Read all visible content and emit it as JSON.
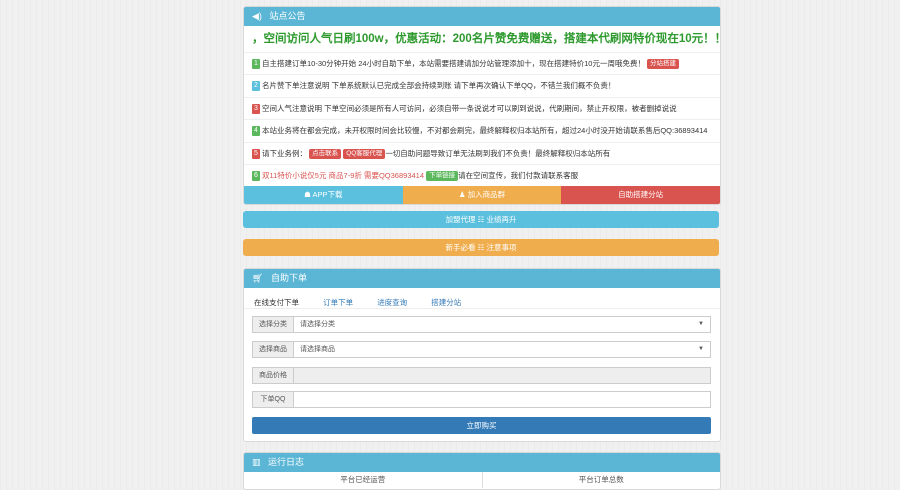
{
  "announce": {
    "title": "站点公告",
    "marquee": "，空间访问人气日刷100w，优惠活动：200名片赞免费赠送，搭建本代刷网特价现在10元！！！",
    "items": [
      {
        "n": "1",
        "color": "#5cb85c",
        "text": "自主搭建订单10-30分钟开始 24小时自助下单，本站需要搭建请加分站管理添加十，现在搭建特价10元一周哦免费！",
        "tag": "分站搭建",
        "tag_color": "#d9534f"
      },
      {
        "n": "2",
        "color": "#5bc0de",
        "text": "名片赞下单注意说明 下单系统默认已完成全部会持续到账 请下单再次确认下单QQ，不错兰我们概不负责！",
        "tag": "",
        "tag_color": ""
      },
      {
        "n": "3",
        "color": "#d9534f",
        "text": "空间人气注意说明 下单空间必须是所有人可访问，必须自带一条说说才可以刷到说说，代刷期间，禁止开权限，被者删掉说说",
        "tag": "",
        "tag_color": ""
      },
      {
        "n": "4",
        "color": "#5cb85c",
        "text": "本站业务将在都会完成，未开权限时间会比较慢，不对都会刷完，最终解释权归本站所有，超过24小时没开始请联系售后QQ:36893414",
        "tag": "",
        "tag_color": ""
      },
      {
        "n": "5",
        "color": "#d9534f",
        "text": "请下业务例：",
        "tag": "点击联系",
        "tag_color": "#d9534f",
        "tag2": "QQ客服代理",
        "text2": "一切自助问题导致订单无法刷到我们不负责！最终解释权归本站所有"
      },
      {
        "n": "6",
        "color": "#5cb85c",
        "text": "双11特价小说仅5元 商品7-9折 需要QQ36893414",
        "tag": "下单链接",
        "tag_color": "#5cb85c",
        "text2": "请在空间宣传，我们付款请联系客服"
      }
    ],
    "buttons": [
      {
        "label": "APP下载",
        "icon": "android-icon",
        "color": "#5bc0de"
      },
      {
        "label": "加入商品群",
        "icon": "users-icon",
        "color": "#f0ad4e"
      },
      {
        "label": "自助搭建分站",
        "icon": "",
        "color": "#d9534f"
      }
    ]
  },
  "agent_bar": {
    "label": "加盟代理 ☷ 业绩再升",
    "color": "#5bc0de"
  },
  "newbie_bar": {
    "label": "新手必看 ☷ 注意事项",
    "color": "#f0ad4e"
  },
  "order": {
    "title": "自助下单",
    "tabs": [
      "在线支付下单",
      "订单下单",
      "进度查询",
      "搭建分站"
    ],
    "fields": [
      {
        "label": "选择分类",
        "value": "请选择分类",
        "select": true
      },
      {
        "label": "选择商品",
        "value": "请选择商品",
        "select": true
      },
      {
        "label": "商品价格",
        "value": "",
        "select": false
      },
      {
        "label": "下单QQ",
        "value": "",
        "select": false
      }
    ],
    "submit": "立即购买"
  },
  "log": {
    "title": "运行日志",
    "cols": [
      "平台已经运营",
      "平台订单总数"
    ]
  }
}
